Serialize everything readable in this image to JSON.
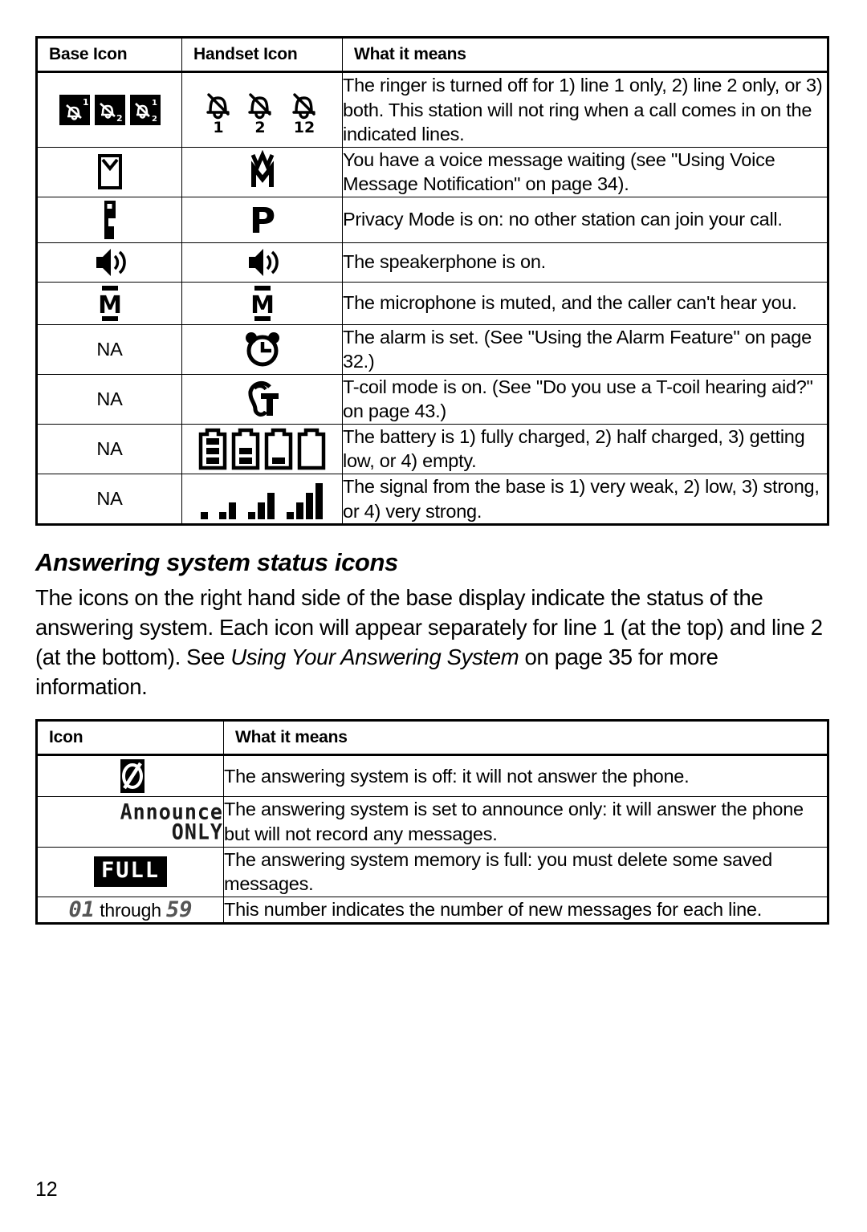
{
  "page": {
    "folio": "12"
  },
  "status_table": {
    "headers": {
      "base": "Base Icon",
      "handset": "Handset Icon",
      "meaning": "What it means"
    },
    "na_label": "NA",
    "rows": [
      {
        "base_icon": "ringer-off-base-icons",
        "handset_icon": "ringer-off-handset-icons",
        "handset_labels": [
          "1",
          "2",
          "12"
        ],
        "meaning": "The ringer is turned off for 1) line 1 only, 2) line 2 only, or 3) both. This station will not ring when a call comes in on the indicated lines."
      },
      {
        "base_icon": "voice-message-base-icon",
        "handset_icon": "voice-message-handset-icon",
        "meaning": "You have a voice message waiting (see \"Using Voice Message Notification\" on page 34)."
      },
      {
        "base_icon": "privacy-mode-base-icon",
        "handset_icon": "privacy-mode-handset-icon",
        "meaning": "Privacy Mode is on: no other station can join your call."
      },
      {
        "base_icon": "speakerphone-base-icon",
        "handset_icon": "speakerphone-handset-icon",
        "meaning": "The speakerphone is on."
      },
      {
        "base_icon": "microphone-mute-base-icon",
        "handset_icon": "microphone-mute-handset-icon",
        "meaning": "The microphone is muted, and the caller can't hear you."
      },
      {
        "base_icon": "na",
        "handset_icon": "alarm-clock-icon",
        "meaning": "The alarm is set. (See \"Using the Alarm Feature\" on page 32.)"
      },
      {
        "base_icon": "na",
        "handset_icon": "t-coil-icon",
        "meaning": "T-coil mode is on. (See \"Do you use a T-coil hearing aid?\" on page 43.)"
      },
      {
        "base_icon": "na",
        "handset_icon": "battery-level-icons",
        "meaning": "The battery is 1) fully charged, 2) half charged, 3) getting low, or 4) empty."
      },
      {
        "base_icon": "na",
        "handset_icon": "signal-strength-icons",
        "meaning": "The signal from the base is 1) very weak, 2) low, 3) strong, or 4) very strong."
      }
    ]
  },
  "section": {
    "heading": "Answering system status icons",
    "paragraph_part1": "The icons on the right hand side of the base display indicate the status of the answering system. Each icon will appear separately for line 1 (at the top) and line 2 (at the bottom). See ",
    "paragraph_italic": "Using Your Answering System",
    "paragraph_part2": " on page 35 for more information."
  },
  "answering_table": {
    "headers": {
      "icon": "Icon",
      "meaning": "What it means"
    },
    "rows": [
      {
        "icon": "answering-system-off-icon",
        "icon_text": "",
        "meaning": "The answering system is off: it will not answer the phone."
      },
      {
        "icon": "announce-only-lcd-text",
        "icon_text_line1": "Announce",
        "icon_text_line2": "ONLY",
        "meaning": "The answering system is set to announce only: it will answer the phone but will not record any messages."
      },
      {
        "icon": "memory-full-lcd-text",
        "icon_text": "FULL",
        "meaning": "The answering system memory is full: you must delete some saved messages."
      },
      {
        "icon": "new-message-count-range",
        "range_low": "01",
        "range_connector": "through",
        "range_high": "59",
        "meaning": "This number indicates the number of new messages for each line."
      }
    ]
  }
}
